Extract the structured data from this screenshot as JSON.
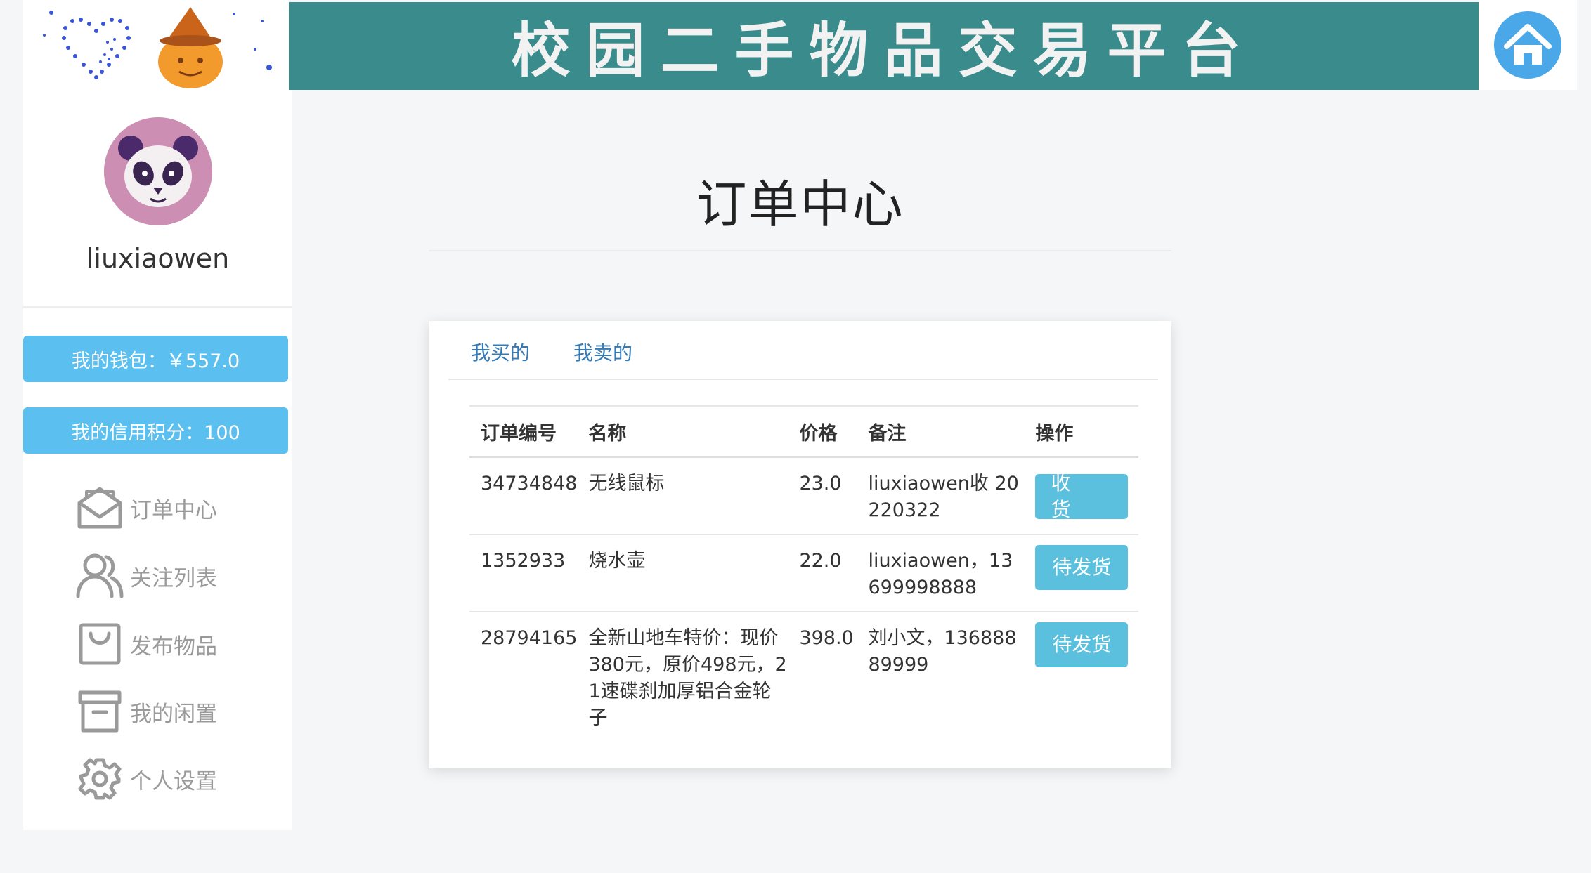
{
  "header": {
    "banner_title": "校园二手物品交易平台",
    "logo_icon": "heart-and-pumpkin-logo",
    "home_icon": "home-icon"
  },
  "sidebar": {
    "username": "liuxiaowen",
    "wallet_label": "我的钱包：￥557.0",
    "credit_label": "我的信用积分：100",
    "nav": [
      {
        "label": "订单中心",
        "icon": "mail-open-icon"
      },
      {
        "label": "关注列表",
        "icon": "users-icon"
      },
      {
        "label": "发布物品",
        "icon": "shopping-bag-icon"
      },
      {
        "label": "我的闲置",
        "icon": "archive-box-icon"
      },
      {
        "label": "个人设置",
        "icon": "gear-icon"
      }
    ]
  },
  "main": {
    "title": "订单中心",
    "tabs": [
      "我买的",
      "我卖的"
    ],
    "table": {
      "headers": [
        "订单编号",
        "名称",
        "价格",
        "备注",
        "操作"
      ],
      "rows": [
        {
          "id": "34734848",
          "name": "无线鼠标",
          "price": "23.0",
          "note": "liuxiaowen收 20220322",
          "action": "收 货"
        },
        {
          "id": "1352933",
          "name": "烧水壶",
          "price": "22.0",
          "note": "liuxiaowen，13699998888",
          "action": "待发货"
        },
        {
          "id": "28794165",
          "name": "全新山地车特价：现价380元，原价498元，21速碟刹加厚铝合金轮子",
          "price": "398.0",
          "note": "刘小文，13688889999",
          "action": "待发货"
        }
      ]
    }
  },
  "colors": {
    "banner": "#3a8b8c",
    "accent_button": "#5bc0f0",
    "action_button": "#5bc0de",
    "tab_link": "#337ab7",
    "home_circle": "#4aa8e8"
  }
}
